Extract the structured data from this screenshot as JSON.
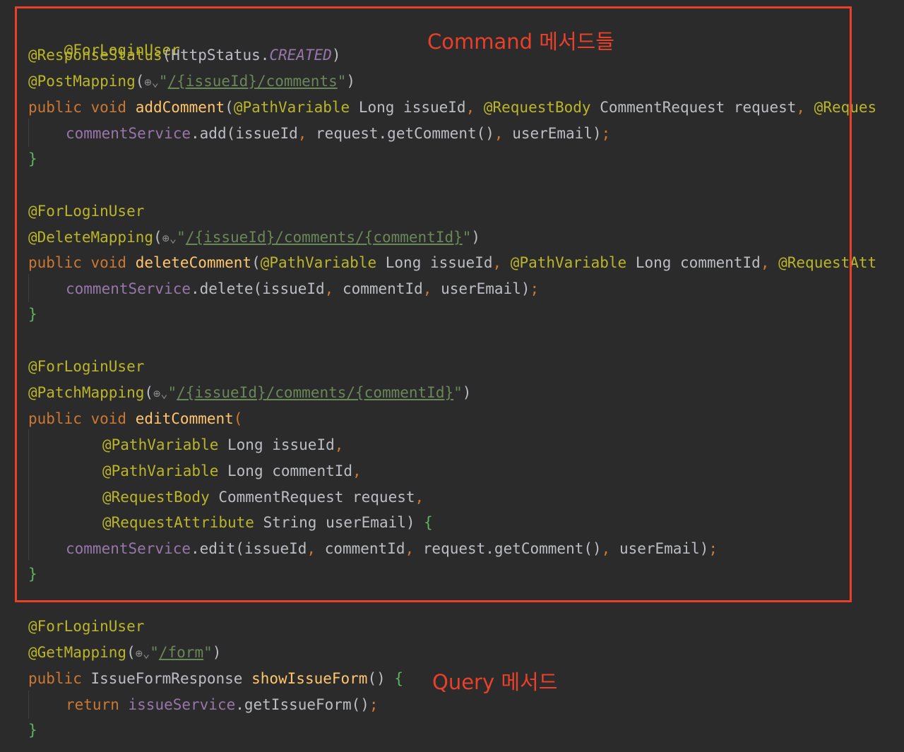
{
  "annotations": {
    "command_note": "Command 메서드들",
    "query_note": "Query 메서드"
  },
  "code": {
    "l1": {
      "a": "@ForLoginUser"
    },
    "l2": {
      "a": "@ResponseStatus",
      "b": "(HttpStatus.",
      "c": "CREATED",
      "d": ")"
    },
    "l3": {
      "a": "@PostMapping",
      "b": "(",
      "c": "\"",
      "d": "/{issueId}/comments",
      "e": "\"",
      "f": ")"
    },
    "l4": {
      "a": "public void ",
      "b": "addComment",
      "c": "(",
      "d": "@PathVariable",
      "e": " Long issueId",
      "f": ", ",
      "g": "@RequestBody",
      "h": " CommentRequest request",
      "i": ", ",
      "j": "@Reques"
    },
    "l5": {
      "a": "commentService",
      "b": ".add(issueId",
      "c": ", ",
      "d": "request.getComment()",
      "e": ", ",
      "f": "userEmail)",
      "g": ";"
    },
    "l6": {
      "a": "}"
    },
    "l7": {
      "a": "@ForLoginUser"
    },
    "l8": {
      "a": "@DeleteMapping",
      "b": "(",
      "c": "\"",
      "d": "/{issueId}/comments/{commentId}",
      "e": "\"",
      "f": ")"
    },
    "l9": {
      "a": "public void ",
      "b": "deleteComment",
      "c": "(",
      "d": "@PathVariable",
      "e": " Long issueId",
      "f": ", ",
      "g": "@PathVariable",
      "h": " Long commentId",
      "i": ", ",
      "j": "@RequestAtt"
    },
    "l10": {
      "a": "commentService",
      "b": ".delete(issueId",
      "c": ", ",
      "d": "commentId",
      "e": ", ",
      "f": "userEmail)",
      "g": ";"
    },
    "l11": {
      "a": "}"
    },
    "l12": {
      "a": "@ForLoginUser"
    },
    "l13": {
      "a": "@PatchMapping",
      "b": "(",
      "c": "\"",
      "d": "/{issueId}/comments/{commentId}",
      "e": "\"",
      "f": ")"
    },
    "l14": {
      "a": "public void ",
      "b": "editComment",
      "c": "("
    },
    "l15": {
      "a": "@PathVariable",
      "b": " Long issueId",
      "c": ","
    },
    "l16": {
      "a": "@PathVariable",
      "b": " Long commentId",
      "c": ","
    },
    "l17": {
      "a": "@RequestBody",
      "b": " CommentRequest request",
      "c": ","
    },
    "l18": {
      "a": "@RequestAttribute",
      "b": " String userEmail) ",
      "c": "{"
    },
    "l19": {
      "a": "commentService",
      "b": ".edit(issueId",
      "c": ", ",
      "d": "commentId",
      "e": ", ",
      "f": "request.getComment()",
      "g": ", ",
      "h": "userEmail)",
      "i": ";"
    },
    "l20": {
      "a": "}"
    },
    "l21": {
      "a": "@ForLoginUser"
    },
    "l22": {
      "a": "@GetMapping",
      "b": "(",
      "c": "\"",
      "d": "/form",
      "e": "\"",
      "f": ")"
    },
    "l23": {
      "a": "public ",
      "b": "IssueFormResponse ",
      "c": "showIssueForm",
      "d": "() ",
      "e": "{"
    },
    "l24": {
      "a": "return ",
      "b": "issueService",
      "c": ".getIssueForm()",
      "d": ";"
    },
    "l25": {
      "a": "}"
    }
  },
  "icons": {
    "endpoint": "globe-icon",
    "endpoint_glyph": "⊕⌄"
  },
  "colors": {
    "background": "#2b2b2b",
    "annotation": "#bbb529",
    "keyword": "#cc7832",
    "method": "#ffc66d",
    "field": "#9876aa",
    "string": "#6a8759",
    "highlight_box": "#e8402b"
  }
}
